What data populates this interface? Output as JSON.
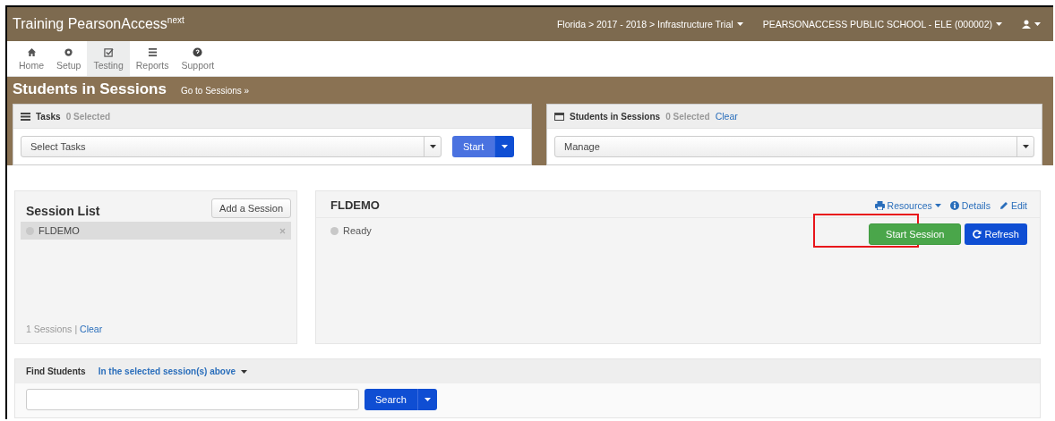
{
  "header": {
    "brand": "Training PearsonAccess",
    "brand_sup": "next",
    "context": "Florida > 2017 - 2018 > Infrastructure Trial",
    "organization": "PEARSONACCESS PUBLIC SCHOOL - ELE (000002)"
  },
  "nav": [
    {
      "label": "Home",
      "selected": false
    },
    {
      "label": "Setup",
      "selected": false
    },
    {
      "label": "Testing",
      "selected": true
    },
    {
      "label": "Reports",
      "selected": false
    },
    {
      "label": "Support",
      "selected": false
    }
  ],
  "page": {
    "title": "Students in Sessions",
    "link": "Go to Sessions »"
  },
  "tasks": {
    "title": "Tasks",
    "count": "0 Selected",
    "select": "Select Tasks",
    "button": "Start"
  },
  "students_panel": {
    "title": "Students in Sessions",
    "count": "0 Selected",
    "clear": "Clear",
    "select": "Manage"
  },
  "session_list": {
    "title": "Session List",
    "add_button": "Add a Session",
    "items": [
      {
        "name": "FLDEMO",
        "selected": true
      }
    ],
    "footer_count": "1 Sessions",
    "footer_sep": "|",
    "footer_clear": "Clear"
  },
  "session": {
    "name": "FLDEMO",
    "links": [
      "Resources",
      "Details",
      "Edit"
    ],
    "status": "Ready",
    "start_button": {
      "label": "Start Session",
      "highlighted": true
    },
    "refresh_button": "Refresh"
  },
  "find": {
    "label": "Find Students",
    "scope": "In the selected session(s) above",
    "search_button": "Search"
  }
}
